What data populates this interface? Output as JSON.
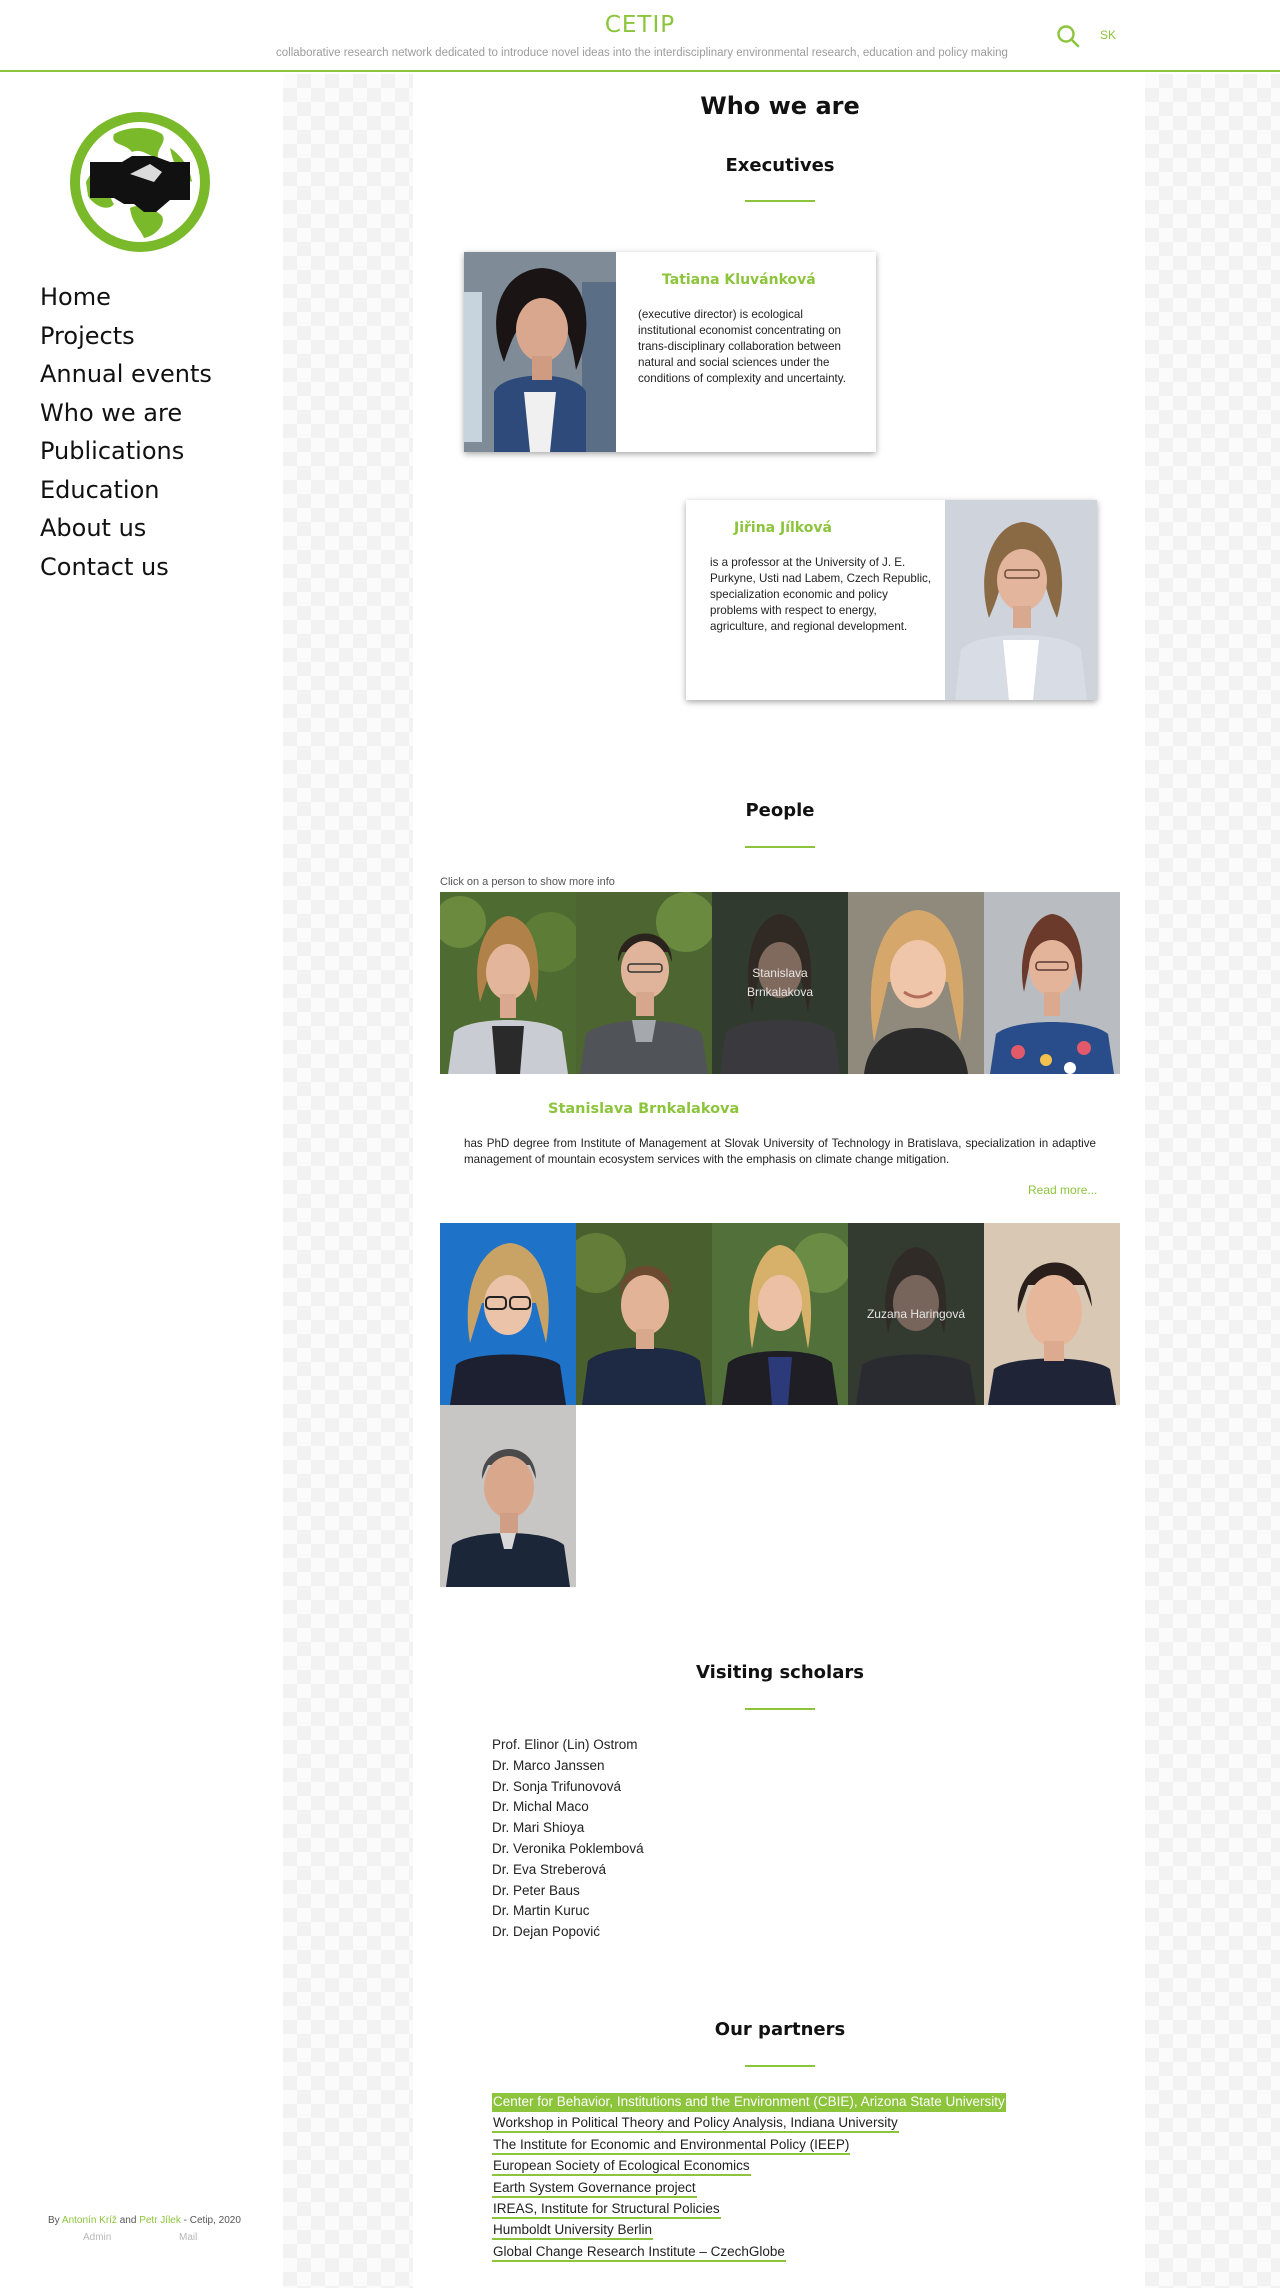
{
  "header": {
    "title": "CETIP",
    "tagline": "collaborative research network dedicated to introduce novel ideas into the interdisciplinary environmental research, education and policy making",
    "search_icon": "search-icon",
    "lang": "SK"
  },
  "colors": {
    "accent": "#8cc43c",
    "text": "#111111"
  },
  "sidebar": {
    "logo": "globe-handshake-logo",
    "nav": [
      "Home",
      "Projects",
      "Annual events",
      "Who we are",
      "Publications",
      "Education",
      "About us",
      "Contact us"
    ],
    "footer": {
      "by": "By",
      "author1": "Antonín Kríž",
      "and": "and",
      "author2": "Petr Jílek",
      "suffix": "- Cetip, 2020",
      "admin": "Admin",
      "mail": "Mail"
    }
  },
  "main": {
    "title": "Who we are",
    "executives": {
      "heading": "Executives",
      "people": [
        {
          "name": "Tatiana Kluvánková",
          "desc": "(executive director) is ecological institutional economist concentrating on trans-disciplinary collaboration between natural and social sciences under the conditions of complexity and uncertainty."
        },
        {
          "name": "Jiřina Jílková",
          "desc": "is a professor at the University of J. E. Purkyne, Usti nad Labem, Czech Republic, specialization economic and policy problems with respect to energy, agriculture, and regional development."
        }
      ]
    },
    "people": {
      "heading": "People",
      "hint": "Click on a person to show more info",
      "selected_overlay": [
        "Stanislava",
        "Brnkalakova"
      ],
      "second_overlay": "Zuzana Haringová",
      "selected": {
        "name": "Stanislava Brnkalakova",
        "desc": "has PhD degree from Institute of Management at Slovak University of Technology in Bratislava, specialization in adaptive management of mountain ecosystem services with the emphasis on climate change mitigation.",
        "read_more": "Read more..."
      }
    },
    "scholars": {
      "heading": "Visiting scholars",
      "list": [
        "Prof. Elinor (Lin) Ostrom",
        "Dr. Marco Janssen",
        "Dr. Sonja Trifunovová",
        "Dr. Michal Maco",
        "Dr. Mari Shioya",
        "Dr. Veronika Poklembová",
        "Dr. Eva Streberová",
        "Dr. Peter Baus",
        "Dr. Martin Kuruc",
        "Dr. Dejan Popović"
      ]
    },
    "partners": {
      "heading": "Our partners",
      "list": [
        "Center for Behavior, Institutions and the Environment (CBIE), Arizona State University",
        "Workshop in Political Theory and Policy Analysis, Indiana University",
        "The Institute for Economic and Environmental Policy (IEEP)",
        "European Society of Ecological Economics",
        "Earth System Governance project",
        "IREAS, Institute for Structural Policies",
        "Humboldt University Berlin",
        "Global Change Research Institute – CzechGlobe"
      ]
    }
  }
}
